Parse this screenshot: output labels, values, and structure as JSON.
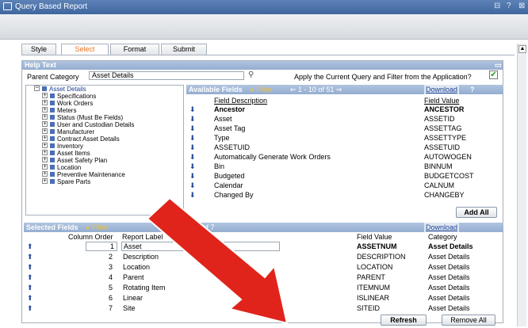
{
  "window": {
    "title": "Query Based Report",
    "buttons": [
      "⊟",
      "?",
      "⊠"
    ]
  },
  "tabs": [
    {
      "label": "Style"
    },
    {
      "label": "Select"
    },
    {
      "label": "Format"
    },
    {
      "label": "Submit"
    }
  ],
  "help": {
    "title": "Help Text"
  },
  "parent_category": {
    "label": "Parent Category",
    "value": "Asset Details"
  },
  "apply": {
    "label": "Apply the Current Query and Filter from the Application?",
    "checked": "✔"
  },
  "tree": {
    "root": "Asset Details",
    "items": [
      "Specifications",
      "Work Orders",
      "Meters",
      "Status (Must Be Fields)",
      "User and Custodian Details",
      "Manufacturer",
      "Contract Asset Details",
      "Inventory",
      "Asset Items",
      "Asset Safety Plan",
      "Location",
      "Preventive Maintenance",
      "Spare Parts"
    ]
  },
  "available_fields": {
    "title": "Available Fields",
    "filter": "Filter",
    "pager": "1 - 10 of 51",
    "download": "Download",
    "help": "?",
    "col_desc": "Field Description",
    "col_value": "Field Value",
    "rows": [
      {
        "desc": "Ancestor",
        "value": "ANCESTOR",
        "bold": "yes"
      },
      {
        "desc": "Asset",
        "value": "ASSETID"
      },
      {
        "desc": "Asset Tag",
        "value": "ASSETTAG"
      },
      {
        "desc": "Type",
        "value": "ASSETTYPE"
      },
      {
        "desc": "ASSETUID",
        "value": "ASSETUID"
      },
      {
        "desc": "Automatically Generate Work Orders",
        "value": "AUTOWOGEN"
      },
      {
        "desc": "Bin",
        "value": "BINNUM"
      },
      {
        "desc": "Budgeted",
        "value": "BUDGETCOST"
      },
      {
        "desc": "Calendar",
        "value": "CALNUM"
      },
      {
        "desc": "Changed By",
        "value": "CHANGEBY"
      }
    ],
    "add_all": "Add All"
  },
  "selected_fields": {
    "title": "Selected Fields",
    "filter": "Filter",
    "pager": "7 of 7",
    "download": "Download",
    "col_order": "Column Order",
    "col_label": "Report Label",
    "col_value": "Field Value",
    "col_category": "Category",
    "rows": [
      {
        "order": "1",
        "label": "Asset",
        "value": "ASSETNUM",
        "category": "Asset Details",
        "bold": "yes"
      },
      {
        "order": "2",
        "label": "Description",
        "value": "DESCRIPTION",
        "category": "Asset Details"
      },
      {
        "order": "3",
        "label": "Location",
        "value": "LOCATION",
        "category": "Asset Details"
      },
      {
        "order": "4",
        "label": "Parent",
        "value": "PARENT",
        "category": "Asset Details"
      },
      {
        "order": "5",
        "label": "Rotating Item",
        "value": "ITEMNUM",
        "category": "Asset Details"
      },
      {
        "order": "6",
        "label": "Linear",
        "value": "ISLINEAR",
        "category": "Asset Details"
      },
      {
        "order": "7",
        "label": "Site",
        "value": "SITEID",
        "category": "Asset Details"
      }
    ],
    "refresh": "Refresh",
    "remove_all": "Remove All"
  },
  "colors": {
    "accent_orange": "#e8731f",
    "header_blue": "#94add0",
    "annotation_red": "#e0241b"
  }
}
